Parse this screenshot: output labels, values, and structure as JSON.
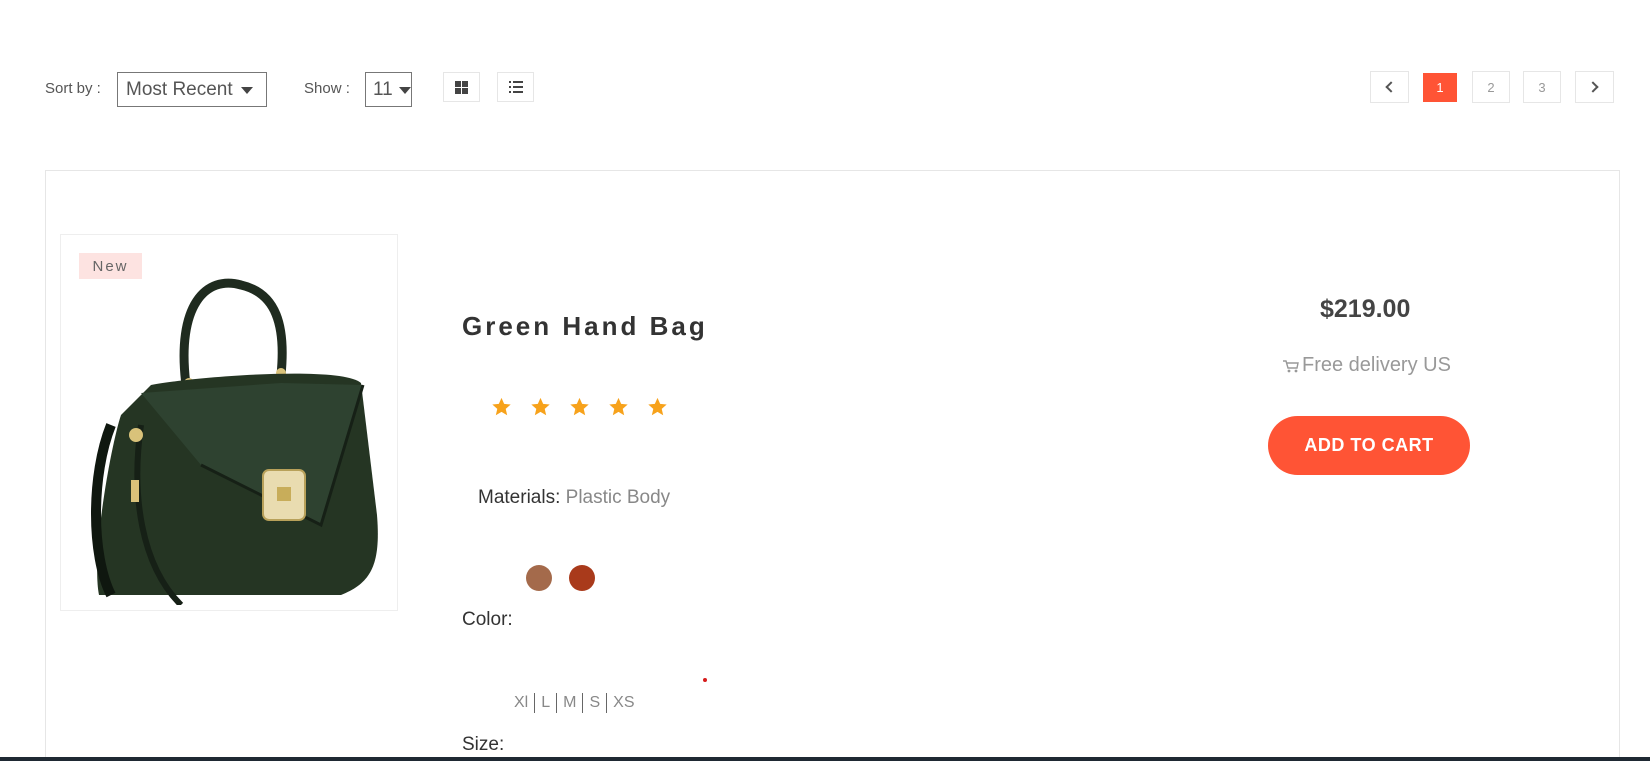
{
  "toolbar": {
    "sort_label": "Sort by :",
    "sort_value": "Most Recent",
    "show_label": "Show :",
    "show_value": "11",
    "grid_view_icon": "grid-icon",
    "list_view_icon": "list-icon"
  },
  "pagination": {
    "prev_icon": "chevron-left-icon",
    "pages": [
      "1",
      "2",
      "3"
    ],
    "current_page": "1",
    "next_icon": "chevron-right-icon"
  },
  "product": {
    "badge": "New",
    "name": "Green Hand Bag",
    "rating": 5,
    "rating_max": 5,
    "materials_label": "Materials:",
    "materials_value": "Plastic Body",
    "color_label": "Color:",
    "colors": [
      "#a46a4b",
      "#a93a1b"
    ],
    "size_label": "Size:",
    "sizes": [
      "Xl",
      "L",
      "M",
      "S",
      "XS"
    ],
    "price": "$219.00",
    "delivery": "Free delivery US",
    "cart_button": "ADD TO CART"
  },
  "theme": {
    "accent": "#ff5435",
    "star_color": "#f7a21b",
    "badge_bg": "#fde3e1"
  }
}
